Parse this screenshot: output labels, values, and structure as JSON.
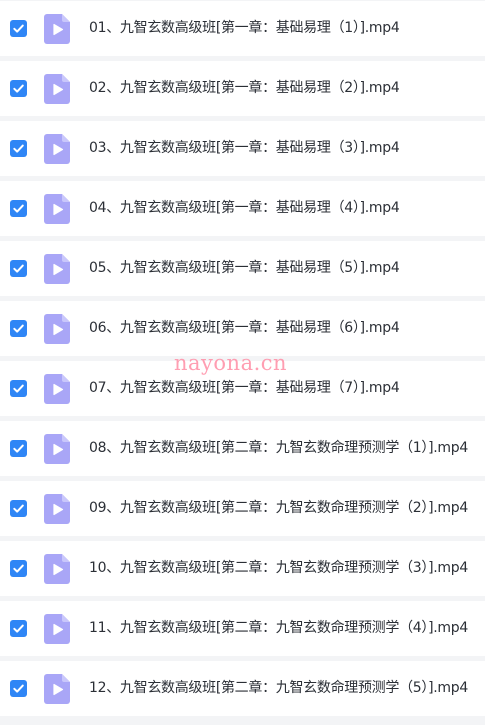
{
  "colors": {
    "checkbox": "#2f86f6",
    "video_icon": "#a9a6f7",
    "row_background": "#ffffff",
    "separator": "#f3f4f6",
    "watermark": "#ff8ea5"
  },
  "files": [
    {
      "checked": true,
      "icon": "video-file-icon",
      "name": "01、九智玄数高级班[第一章：基础易理（1）].mp4"
    },
    {
      "checked": true,
      "icon": "video-file-icon",
      "name": "02、九智玄数高级班[第一章：基础易理（2）].mp4"
    },
    {
      "checked": true,
      "icon": "video-file-icon",
      "name": "03、九智玄数高级班[第一章：基础易理（3）].mp4"
    },
    {
      "checked": true,
      "icon": "video-file-icon",
      "name": "04、九智玄数高级班[第一章：基础易理（4）].mp4"
    },
    {
      "checked": true,
      "icon": "video-file-icon",
      "name": "05、九智玄数高级班[第一章：基础易理（5）].mp4"
    },
    {
      "checked": true,
      "icon": "video-file-icon",
      "name": "06、九智玄数高级班[第一章：基础易理（6）].mp4"
    },
    {
      "checked": true,
      "icon": "video-file-icon",
      "name": "07、九智玄数高级班[第一章：基础易理（7）].mp4"
    },
    {
      "checked": true,
      "icon": "video-file-icon",
      "name": "08、九智玄数高级班[第二章：九智玄数命理预测学（1）].mp4"
    },
    {
      "checked": true,
      "icon": "video-file-icon",
      "name": "09、九智玄数高级班[第二章：九智玄数命理预测学（2）].mp4"
    },
    {
      "checked": true,
      "icon": "video-file-icon",
      "name": "10、九智玄数高级班[第二章：九智玄数命理预测学（3）].mp4"
    },
    {
      "checked": true,
      "icon": "video-file-icon",
      "name": "11、九智玄数高级班[第二章：九智玄数命理预测学（4）].mp4"
    },
    {
      "checked": true,
      "icon": "video-file-icon",
      "name": "12、九智玄数高级班[第二章：九智玄数命理预测学（5）].mp4"
    }
  ],
  "watermark": "nayona.cn"
}
